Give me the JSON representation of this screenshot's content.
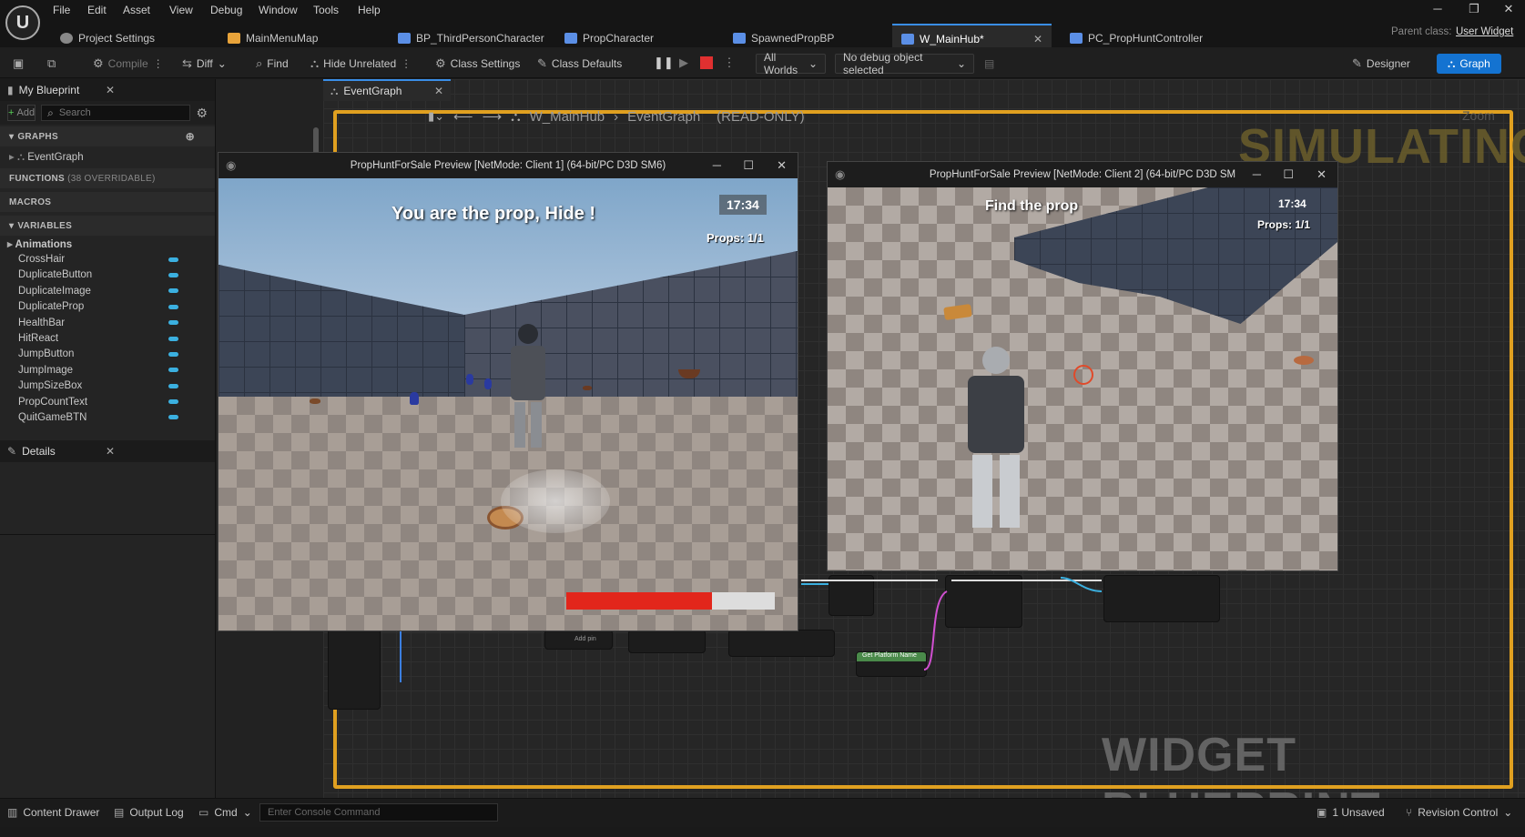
{
  "menu": [
    "File",
    "Edit",
    "Asset",
    "View",
    "Debug",
    "Window",
    "Tools",
    "Help"
  ],
  "tabs": [
    {
      "label": "Project Settings"
    },
    {
      "label": "MainMenuMap"
    },
    {
      "label": "BP_ThirdPersonCharacter"
    },
    {
      "label": "PropCharacter"
    },
    {
      "label": "SpawnedPropBP"
    },
    {
      "label": "W_MainHub*"
    },
    {
      "label": "PC_PropHuntController"
    }
  ],
  "parent_class": {
    "label": "Parent class:",
    "value": "User Widget"
  },
  "toolbar": {
    "compile": "Compile",
    "diff": "Diff",
    "find": "Find",
    "hide_unrelated": "Hide Unrelated",
    "class_settings": "Class Settings",
    "class_defaults": "Class Defaults",
    "worlds": "All Worlds",
    "debug_object": "No debug object selected",
    "designer": "Designer",
    "graph": "Graph"
  },
  "my_blueprint": {
    "title": "My Blueprint",
    "add": "Add",
    "search_placeholder": "Search",
    "graphs_header": "GRAPHS",
    "event_graph": "EventGraph",
    "functions_header": "FUNCTIONS",
    "functions_count": "(38 OVERRIDABLE)",
    "macros_header": "MACROS",
    "variables_header": "VARIABLES",
    "animations": "Animations",
    "variables": [
      "CrossHair",
      "DuplicateButton",
      "DuplicateImage",
      "DuplicateProp",
      "HealthBar",
      "HitReact",
      "JumpButton",
      "JumpImage",
      "JumpSizeBox",
      "PropCountText",
      "QuitGameBTN"
    ]
  },
  "details": {
    "title": "Details"
  },
  "graph_tab": {
    "label": "EventGraph"
  },
  "breadcrumb": {
    "blueprint": "W_MainHub",
    "graph": "EventGraph",
    "mode": "(READ-ONLY)"
  },
  "zoom_label": "Zoom",
  "watermarks": {
    "simulating": "SIMULATING",
    "widget_blueprint": "WIDGET BLUEPRINT"
  },
  "nodes": {
    "get_platform_name": "Get Platform Name",
    "add_pin": "Add pin"
  },
  "client1": {
    "title": "PropHuntForSale Preview [NetMode: Client 1]  (64-bit/PC D3D SM6)",
    "message": "You are the prop, Hide !",
    "time": "17:34",
    "props": "Props: 1/1",
    "health_fraction": 0.7
  },
  "client2": {
    "title": "PropHuntForSale Preview [NetMode: Client 2]  (64-bit/PC D3D SM",
    "message": "Find the prop",
    "time": "17:34",
    "props": "Props: 1/1"
  },
  "bottom": {
    "content_drawer": "Content Drawer",
    "output_log": "Output Log",
    "cmd": "Cmd",
    "console_placeholder": "Enter Console Command",
    "unsaved": "1 Unsaved",
    "revision_control": "Revision Control"
  },
  "colors": {
    "accent": "#1473d1",
    "frame": "#e0a020",
    "health": "#e2261b",
    "var_pill": "#3bb0e0"
  }
}
